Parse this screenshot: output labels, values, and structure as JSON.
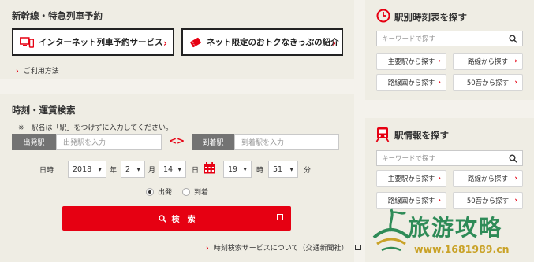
{
  "shinkansen": {
    "title": "新幹線・特急列車予約",
    "internet_booking_label": "インターネット列車予約サービス",
    "net_tickets_label": "ネット限定のおトクなきっぷの紹介",
    "usage_link": "ご利用方法"
  },
  "search": {
    "title": "時刻・運賃検索",
    "note": "※　駅名は「駅」をつけずに入力してください。",
    "departure_label": "出発駅",
    "departure_placeholder": "出発駅を入力",
    "arrival_label": "到着駅",
    "arrival_placeholder": "到着駅を入力",
    "datetime_label": "日時",
    "year": "2018",
    "year_unit": "年",
    "month": "2",
    "month_unit": "月",
    "day": "14",
    "day_unit": "日",
    "hour": "19",
    "hour_unit": "時",
    "minute": "51",
    "minute_unit": "分",
    "radio_depart": "出発",
    "radio_arrive": "到着",
    "selected_radio": "出発",
    "search_button": "検　索",
    "about_link": "時刻検索サービスについて（交通新聞社）"
  },
  "timetable": {
    "title": "駅別時刻表を探す",
    "keyword_placeholder": "キーワードで探す",
    "buttons": [
      "主要駅から探す",
      "路線から探す",
      "路線図から探す",
      "50音から探す"
    ]
  },
  "station": {
    "title": "駅情報を探す",
    "keyword_placeholder": "キーワードで探す",
    "buttons": [
      "主要駅から探す",
      "路線から探す",
      "路線図から探す",
      "50音から探す"
    ]
  },
  "watermark": {
    "text": "旅游攻略",
    "url": "www.1681989.cn"
  },
  "colors": {
    "accent": "#e60012",
    "panel_bg": "#efede4",
    "label_bg": "#737373"
  }
}
